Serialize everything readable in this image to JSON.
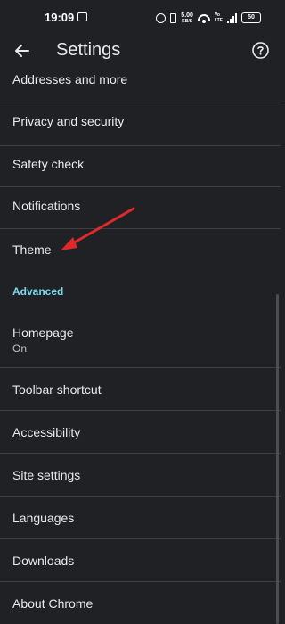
{
  "status_bar": {
    "time": "19:09",
    "speed_value": "5.00",
    "speed_unit": "KB/S",
    "volte_top": "Vo",
    "volte_bottom": "LTE",
    "battery": "50"
  },
  "header": {
    "title": "Settings"
  },
  "settings": {
    "items": [
      {
        "label": "Addresses and more"
      },
      {
        "label": "Privacy and security"
      },
      {
        "label": "Safety check"
      },
      {
        "label": "Notifications"
      },
      {
        "label": "Theme"
      }
    ],
    "advanced_header": "Advanced",
    "advanced_items": [
      {
        "label": "Homepage",
        "value": "On"
      },
      {
        "label": "Toolbar shortcut"
      },
      {
        "label": "Accessibility"
      },
      {
        "label": "Site settings"
      },
      {
        "label": "Languages"
      },
      {
        "label": "Downloads"
      },
      {
        "label": "About Chrome"
      }
    ]
  },
  "colors": {
    "background": "#202124",
    "text": "#e8eaed",
    "section_header": "#78d9ec",
    "divider": "#3c4043",
    "annotation_arrow": "#e02828"
  },
  "icons": {
    "back": "arrow-left-icon",
    "help": "help-circle-icon",
    "annotation": "red-arrow-icon"
  }
}
